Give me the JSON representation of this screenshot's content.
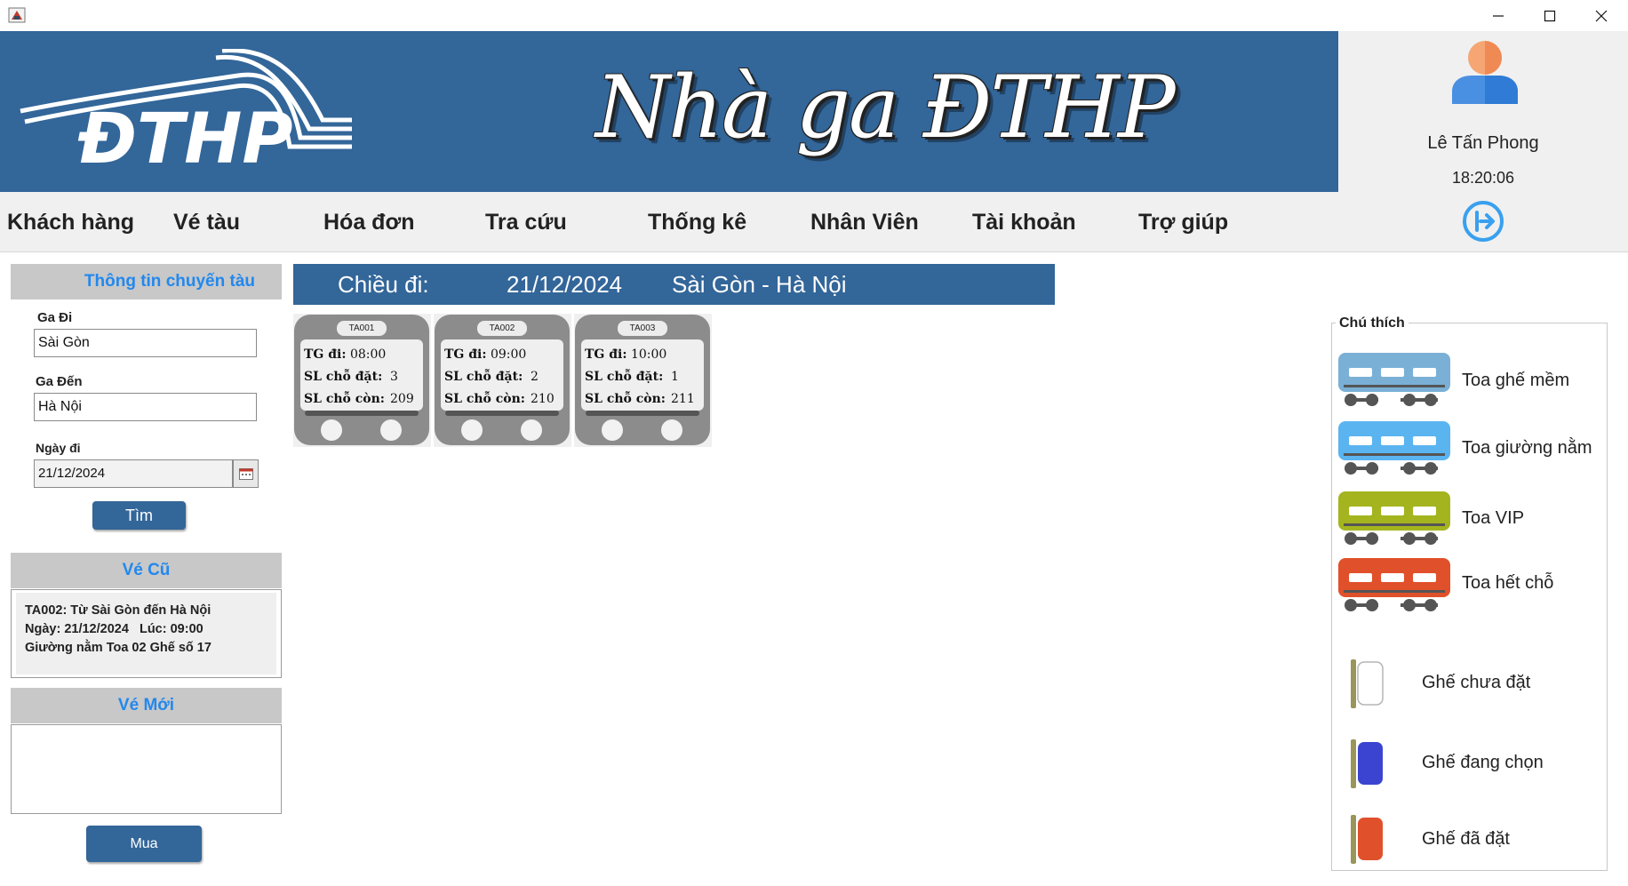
{
  "window": {
    "icon": "java-app-icon",
    "controls": [
      "minimize-icon",
      "maximize-icon",
      "close-icon"
    ]
  },
  "header": {
    "logo_text": "ĐTHP",
    "title": "Nhà ga ĐTHP"
  },
  "user": {
    "name": "Lê Tấn Phong",
    "time": "18:20:06"
  },
  "menu": [
    {
      "label": "Khách hàng"
    },
    {
      "label": "Vé tàu"
    },
    {
      "label": "Hóa đơn"
    },
    {
      "label": "Tra cứu"
    },
    {
      "label": "Thống kê"
    },
    {
      "label": "Nhân Viên"
    },
    {
      "label": "Tài khoản"
    },
    {
      "label": "Trợ giúp"
    }
  ],
  "search": {
    "title": "Thông tin chuyến tàu",
    "from_label": "Ga Đi",
    "from_value": "Sài Gòn",
    "to_label": "Ga Đến",
    "to_value": "Hà Nội",
    "date_label": "Ngày đi",
    "date_value": "21/12/2024",
    "button": "Tìm"
  },
  "old_ticket": {
    "title": "Vé Cũ",
    "line1": "TA002: Từ Sài Gòn đến Hà Nội",
    "line2": "Ngày: 21/12/2024   Lúc: 09:00",
    "line3": "Giường nằm Toa 02 Ghế số 17"
  },
  "new_ticket": {
    "title": "Vé Mới",
    "buy_button": "Mua"
  },
  "route": {
    "direction": "Chiều đi:",
    "date": "21/12/2024",
    "path": "Sài Gòn - Hà Nội"
  },
  "trains": [
    {
      "code": "TA001",
      "depart_label": "TG đi:",
      "depart": "08:00",
      "booked_label": "SL chỗ đặt:",
      "booked": "3",
      "remain_label": "SL chỗ còn:",
      "remain": "209"
    },
    {
      "code": "TA002",
      "depart_label": "TG đi:",
      "depart": "09:00",
      "booked_label": "SL chỗ đặt:",
      "booked": "2",
      "remain_label": "SL chỗ còn:",
      "remain": "210"
    },
    {
      "code": "TA003",
      "depart_label": "TG đi:",
      "depart": "10:00",
      "booked_label": "SL chỗ đặt:",
      "booked": "1",
      "remain_label": "SL chỗ còn:",
      "remain": "211"
    }
  ],
  "legend": {
    "title": "Chú thích",
    "cars": [
      {
        "label": "Toa ghế mềm",
        "color": "#7ab0d6"
      },
      {
        "label": "Toa giường nằm",
        "color": "#5ab4f0"
      },
      {
        "label": "Toa VIP",
        "color": "#a4b41e"
      },
      {
        "label": "Toa hết chỗ",
        "color": "#e0502a"
      }
    ],
    "seats": [
      {
        "label": "Ghế chưa đặt",
        "color": "#ffffff"
      },
      {
        "label": "Ghế đang chọn",
        "color": "#3a44d0"
      },
      {
        "label": "Ghế đã đặt",
        "color": "#e0502a"
      }
    ]
  },
  "colors": {
    "primary": "#336699",
    "section_header": "#c8c8c8",
    "section_text": "#2288ee"
  }
}
